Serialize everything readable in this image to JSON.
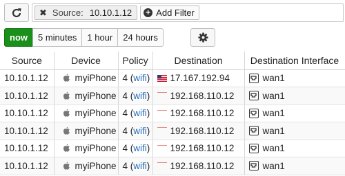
{
  "toolbar": {
    "refresh_icon": "refresh-icon",
    "filter_chip": {
      "key": "Source:",
      "value": "10.10.1.12",
      "remove_icon": "close-icon"
    },
    "add_filter_label": "Add Filter",
    "add_filter_icon": "plus-circle-icon"
  },
  "time_range": {
    "options": [
      "now",
      "5 minutes",
      "1 hour",
      "24 hours"
    ],
    "selected": "now",
    "settings_icon": "gear-icon"
  },
  "table": {
    "columns": [
      "Source",
      "Device",
      "Policy",
      "Destination",
      "Destination Interface"
    ],
    "rows": [
      {
        "source": "10.10.1.12",
        "device_icon": "apple-icon",
        "device": "myiPhone",
        "policy_num": "4",
        "policy_name": "wifi",
        "flag": "us-flag",
        "destination": "17.167.192.94",
        "interface_icon": "network-port-icon",
        "interface": "wan1"
      },
      {
        "source": "10.10.1.12",
        "device_icon": "apple-icon",
        "device": "myiPhone",
        "policy_num": "4",
        "policy_name": "wifi",
        "flag": "private-flag",
        "destination": "192.168.110.12",
        "interface_icon": "network-port-icon",
        "interface": "wan1"
      },
      {
        "source": "10.10.1.12",
        "device_icon": "apple-icon",
        "device": "myiPhone",
        "policy_num": "4",
        "policy_name": "wifi",
        "flag": "private-flag",
        "destination": "192.168.110.12",
        "interface_icon": "network-port-icon",
        "interface": "wan1"
      },
      {
        "source": "10.10.1.12",
        "device_icon": "apple-icon",
        "device": "myiPhone",
        "policy_num": "4",
        "policy_name": "wifi",
        "flag": "private-flag",
        "destination": "192.168.110.12",
        "interface_icon": "network-port-icon",
        "interface": "wan1"
      },
      {
        "source": "10.10.1.12",
        "device_icon": "apple-icon",
        "device": "myiPhone",
        "policy_num": "4",
        "policy_name": "wifi",
        "flag": "private-flag",
        "destination": "192.168.110.12",
        "interface_icon": "network-port-icon",
        "interface": "wan1"
      },
      {
        "source": "10.10.1.12",
        "device_icon": "apple-icon",
        "device": "myiPhone",
        "policy_num": "4",
        "policy_name": "wifi",
        "flag": "private-flag",
        "destination": "192.168.110.12",
        "interface_icon": "network-port-icon",
        "interface": "wan1"
      }
    ]
  },
  "colors": {
    "active_green": "#1a8f1a",
    "link_blue": "#2a6ebb"
  }
}
